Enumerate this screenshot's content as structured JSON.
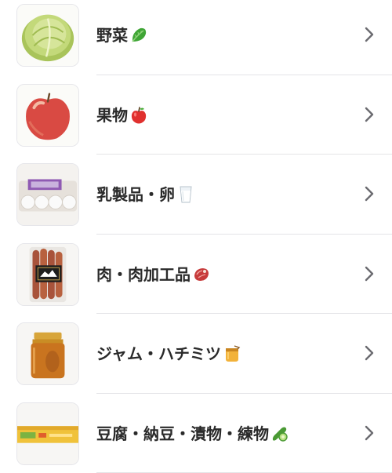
{
  "categories": [
    {
      "label": "野菜",
      "thumb_icon": "cabbage-thumbnail",
      "emoji_icon": "leafy-greens-emoji"
    },
    {
      "label": "果物",
      "thumb_icon": "apple-thumbnail",
      "emoji_icon": "red-apple-emoji"
    },
    {
      "label": "乳製品・卵",
      "thumb_icon": "egg-carton-thumbnail",
      "emoji_icon": "milk-glass-emoji"
    },
    {
      "label": "肉・肉加工品",
      "thumb_icon": "sausage-pack-thumbnail",
      "emoji_icon": "cut-of-meat-emoji"
    },
    {
      "label": "ジャム・ハチミツ",
      "thumb_icon": "honey-jar-thumbnail",
      "emoji_icon": "honey-pot-emoji"
    },
    {
      "label": "豆腐・納豆・漬物・練物",
      "thumb_icon": "tofu-pack-thumbnail",
      "emoji_icon": "cucumber-emoji"
    }
  ],
  "chevron_icon": "chevron-right-icon",
  "colors": {
    "text": "#2a2a2a",
    "chevron": "#6b6b70",
    "divider": "#e4e4e7",
    "thumb_border": "#e6e6ea"
  }
}
